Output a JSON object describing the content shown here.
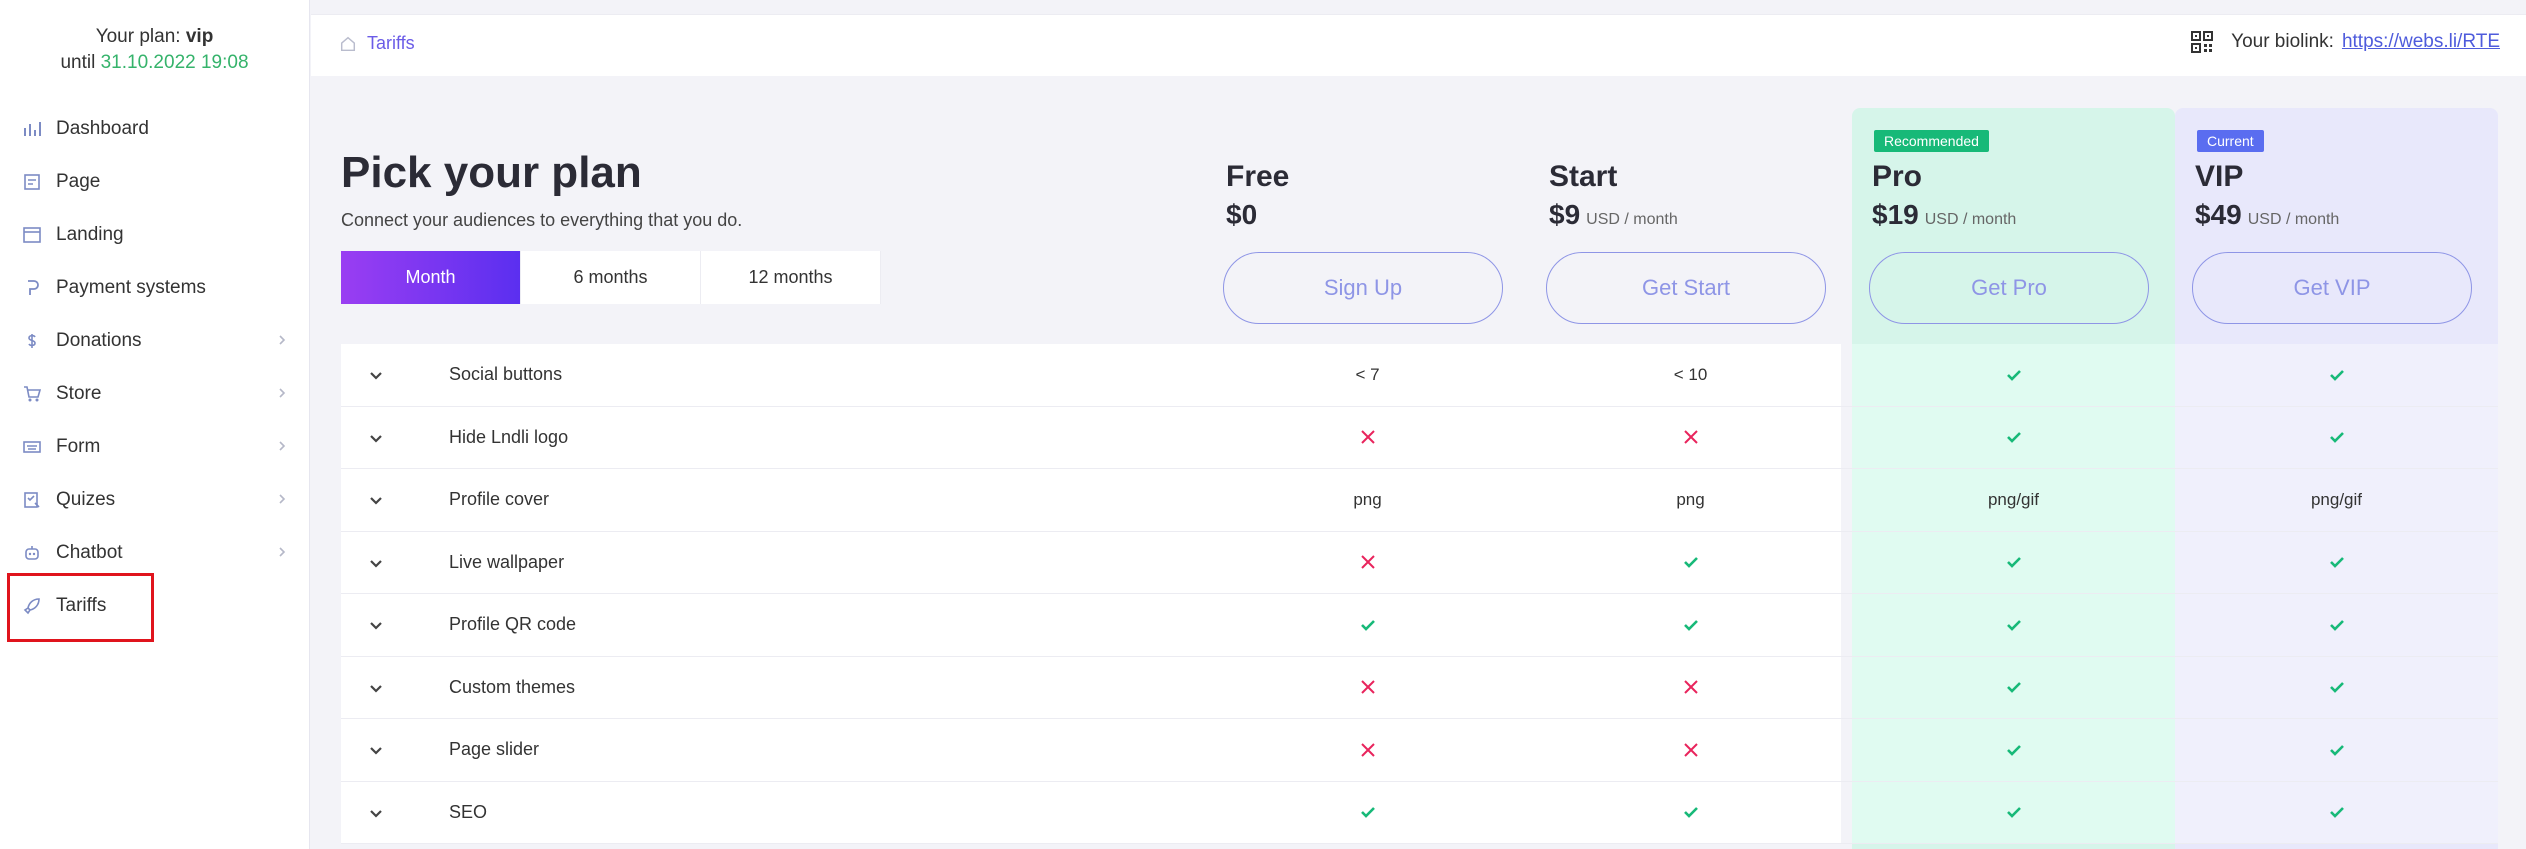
{
  "sidebar": {
    "plan_label": "Your plan:",
    "plan_name": "vip",
    "until_label": "until",
    "until_date": "31.10.2022 19:08",
    "items": [
      {
        "label": "Dashboard",
        "icon": "chart-icon",
        "chevron": false
      },
      {
        "label": "Page",
        "icon": "page-icon",
        "chevron": false
      },
      {
        "label": "Landing",
        "icon": "landing-icon",
        "chevron": false
      },
      {
        "label": "Payment systems",
        "icon": "payment-icon",
        "chevron": false
      },
      {
        "label": "Donations",
        "icon": "dollar-icon",
        "chevron": true
      },
      {
        "label": "Store",
        "icon": "cart-icon",
        "chevron": true
      },
      {
        "label": "Form",
        "icon": "keyboard-icon",
        "chevron": true
      },
      {
        "label": "Quizes",
        "icon": "quiz-icon",
        "chevron": true
      },
      {
        "label": "Chatbot",
        "icon": "bot-icon",
        "chevron": true
      },
      {
        "label": "Tariffs",
        "icon": "rocket-icon",
        "chevron": false
      }
    ]
  },
  "topbar": {
    "breadcrumb": "Tariffs",
    "biolink_label": "Your biolink:",
    "biolink_url": "https://webs.li/RTE"
  },
  "main": {
    "title": "Pick your plan",
    "subtitle": "Connect your audiences to everything that you do.",
    "periods": [
      "Month",
      "6 months",
      "12 months"
    ],
    "active_period": "Month",
    "plans": [
      {
        "name": "Free",
        "price": "$0",
        "per": "",
        "cta": "Sign Up",
        "badge": ""
      },
      {
        "name": "Start",
        "price": "$9",
        "per": "USD / month",
        "cta": "Get Start",
        "badge": ""
      },
      {
        "name": "Pro",
        "price": "$19",
        "per": "USD / month",
        "cta": "Get Pro",
        "badge": "Recommended",
        "badge_color": "#17b978"
      },
      {
        "name": "VIP",
        "price": "$49",
        "per": "USD / month",
        "cta": "Get VIP",
        "badge": "Current",
        "badge_color": "#5a6df0"
      }
    ],
    "features": [
      {
        "name": "Social buttons",
        "values": [
          "< 7",
          "< 10",
          "check",
          "check"
        ]
      },
      {
        "name": "Hide Lndli logo",
        "values": [
          "cross",
          "cross",
          "check",
          "check"
        ]
      },
      {
        "name": "Profile cover",
        "values": [
          "png",
          "png",
          "png/gif",
          "png/gif"
        ]
      },
      {
        "name": "Live wallpaper",
        "values": [
          "cross",
          "check",
          "check",
          "check"
        ]
      },
      {
        "name": "Profile QR code",
        "values": [
          "check",
          "check",
          "check",
          "check"
        ]
      },
      {
        "name": "Custom themes",
        "values": [
          "cross",
          "cross",
          "check",
          "check"
        ]
      },
      {
        "name": "Page slider",
        "values": [
          "cross",
          "cross",
          "check",
          "check"
        ]
      },
      {
        "name": "SEO",
        "values": [
          "check",
          "check",
          "check",
          "check"
        ]
      }
    ]
  },
  "colors": {
    "check": "#17b978",
    "cross": "#e8245c",
    "accent": "#6b5ce7"
  }
}
